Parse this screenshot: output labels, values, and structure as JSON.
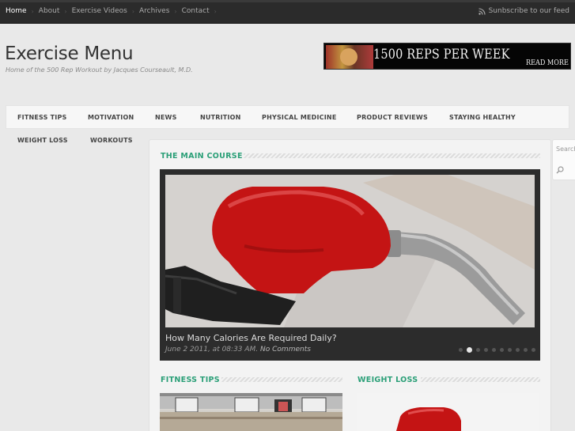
{
  "topnav": {
    "items": [
      {
        "label": "Home"
      },
      {
        "label": "About"
      },
      {
        "label": "Exercise Videos"
      },
      {
        "label": "Archives"
      },
      {
        "label": "Contact"
      }
    ],
    "subscribe": "Sunbscribe to our feed"
  },
  "header": {
    "title": "Exercise Menu",
    "tagline": "Home of the 500 Rep Workout by Jacques Courseault, M.D."
  },
  "banner": {
    "headline": "1500 REPS PER WEEK",
    "cta": "READ MORE"
  },
  "categories": [
    {
      "label": "FITNESS TIPS"
    },
    {
      "label": "MOTIVATION"
    },
    {
      "label": "NEWS"
    },
    {
      "label": "NUTRITION"
    },
    {
      "label": "PHYSICAL MEDICINE"
    },
    {
      "label": "PRODUCT REVIEWS"
    },
    {
      "label": "STAYING HEALTHY"
    },
    {
      "label": "WEIGHT LOSS"
    },
    {
      "label": "WORKOUTS"
    }
  ],
  "main": {
    "heading": "THE MAIN COURSE",
    "slide": {
      "title": "How Many Calories Are Required Daily?",
      "date": "June 2 2011, at 08:33 AM.",
      "comments": "No Comments",
      "dot_count": 10,
      "active_dot": 1
    },
    "sections": [
      {
        "heading": "FITNESS TIPS"
      },
      {
        "heading": "WEIGHT LOSS"
      }
    ]
  },
  "search": {
    "placeholder": "Search"
  },
  "colors": {
    "accent": "#2a9f77",
    "topbar": "#2b2b2b",
    "pump_red": "#c41414"
  }
}
